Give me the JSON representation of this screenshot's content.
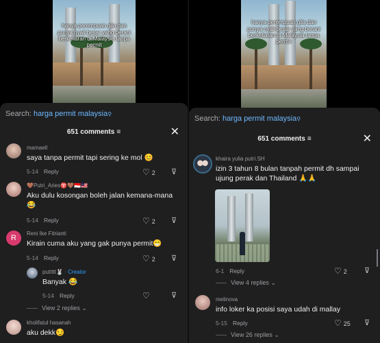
{
  "left": {
    "video_caption": "hanya perempuan gila dan punya nyali besar yang berani berkeliaran di Malaysia tanpa permit",
    "search_label": "Search:",
    "search_query": "harga permit malaysia",
    "search_icon": "search-icon",
    "comments_count": "651 comments",
    "filter_icon": "filter-icon",
    "close_icon": "close-icon",
    "reply_label": "Reply",
    "comments": [
      {
        "username": "mamaell",
        "text": "saya tanpa permit tapi sering ke mol 😊",
        "date": "5-14",
        "likes": "2"
      },
      {
        "username": "🤎Putri_Aries♈🤎🇮🇩🇲🇾",
        "text": "Aku dulu kosongan boleh jalan kemana-mana 😂",
        "date": "5-14",
        "likes": "2"
      },
      {
        "username": "Reni Ike Fitrianti",
        "avatar_letter": "R",
        "text": "Kirain cuma aku yang gak punya permit😁",
        "date": "5-14",
        "likes": "2"
      },
      {
        "username": "puttttt🐰",
        "creator": "· Creator",
        "text": "Banyak 😂",
        "date": "5-14",
        "likes": ""
      },
      {
        "username": "kholifatul hasanah",
        "text": "aku dekk😏"
      }
    ],
    "view_replies": "View 2 replies"
  },
  "right": {
    "video_caption": "hanya perempuan gila dan punya nyali besar yang berani berkeliaran di Malaysia tanpa permit",
    "search_label": "Search:",
    "search_query": "harga permit malaysia",
    "search_icon": "search-icon",
    "comments_count": "651 comments",
    "filter_icon": "filter-icon",
    "close_icon": "close-icon",
    "reply_label": "Reply",
    "comments": [
      {
        "username": "khaira yulia putri.SH",
        "text": "izin 3 tahun 8 bulan tanpah permit dh sampai ujung perak dan Thailand 🙏🙏",
        "date": "6-1",
        "likes": "2",
        "view_replies": "View 4 replies"
      },
      {
        "username": "melinova",
        "text": "info loker ka posisi saya udah di mallay",
        "date": "5-15",
        "likes": "25",
        "view_replies": "View 26 replies"
      }
    ]
  },
  "icons": {
    "heart": "heart-icon",
    "dislike": "dislike-icon",
    "chevron": "chevron-down-icon"
  }
}
